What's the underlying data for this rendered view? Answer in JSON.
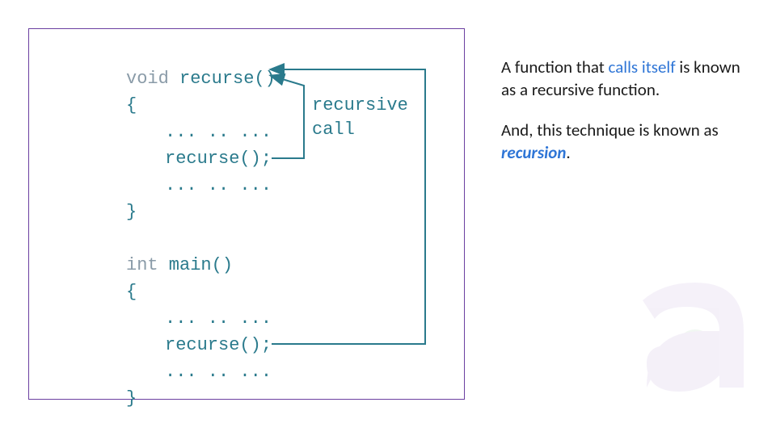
{
  "code": {
    "recurse_sig_kw": "void",
    "recurse_sig_name": " recurse()",
    "open_brace": "{",
    "dots": "... .. ...",
    "recurse_call": "recurse();",
    "close_brace": "}",
    "main_sig_kw": "int",
    "main_sig_name": " main()"
  },
  "annotation": {
    "line1": "recursive",
    "line2": "call"
  },
  "explanation": {
    "p1_a": "A function that ",
    "p1_hl": "calls itself",
    "p1_b": " is known as a recursive function.",
    "p2_a": "And, this technique is known as ",
    "p2_hl": "recursion",
    "p2_b": "."
  },
  "colors": {
    "teal": "#2a7a8c",
    "kw_gray": "#8a9ba8",
    "blue": "#2e75d6",
    "border": "#6b3fa0"
  }
}
